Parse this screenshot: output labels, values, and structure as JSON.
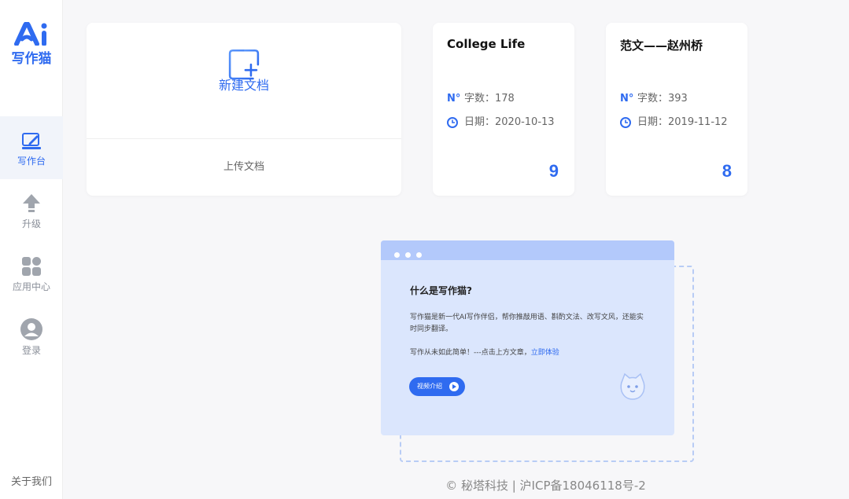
{
  "sidebar": {
    "logo_text": "写作猫",
    "items": [
      {
        "label": "写作台",
        "icon": "edit-icon",
        "active": true
      },
      {
        "label": "升级",
        "icon": "upgrade-arrow-icon",
        "active": false
      },
      {
        "label": "应用中心",
        "icon": "apps-grid-icon",
        "active": false
      },
      {
        "label": "登录",
        "icon": "user-avatar-icon",
        "active": false
      }
    ],
    "about": "关于我们"
  },
  "new_doc": {
    "label": "新建文档",
    "upload_label": "上传文档",
    "icon": "new-document-icon"
  },
  "documents": [
    {
      "title": "College Life",
      "wordcount_label": "字数：",
      "wordcount": "178",
      "date_label": "日期：",
      "date": "2020-10-13",
      "count": "9"
    },
    {
      "title": "范文——赵州桥",
      "wordcount_label": "字数：",
      "wordcount": "393",
      "date_label": "日期：",
      "date": "2019-11-12",
      "count": "8"
    }
  ],
  "intro": {
    "title": "什么是写作猫?",
    "desc": "写作猫是新一代AI写作伴侣，帮你推敲用语、斟酌文法、改写文风，还能实时同步翻译。",
    "line2_prefix": "写作从未如此简单！---点击上方文章，",
    "line2_link": "立即体验",
    "video_button": "视频介绍"
  },
  "footer": {
    "text": "© 秘塔科技 | 沪ICP备18046118号-2"
  },
  "colors": {
    "accent": "#2f6bf0",
    "background": "#f7f7f9",
    "illustration_bg": "#dbe6fd"
  }
}
